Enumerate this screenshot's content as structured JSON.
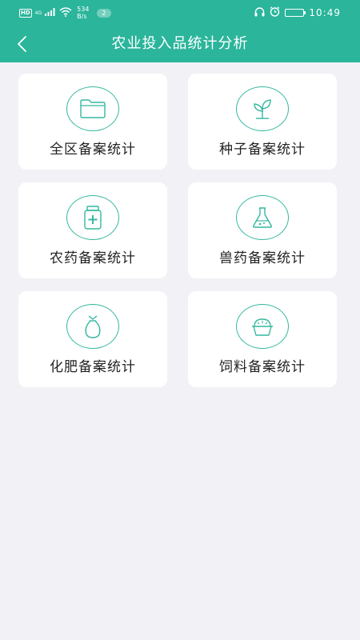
{
  "status_bar": {
    "hd": "HD",
    "network": "4G",
    "speed_value": "534",
    "speed_unit": "B/s",
    "notification_count": "2",
    "time": "10:49"
  },
  "header": {
    "title": "农业投入品统计分析",
    "back_icon": "chevron-left-icon"
  },
  "menu": [
    {
      "label": "全区备案统计",
      "icon": "folder-icon"
    },
    {
      "label": "种子备案统计",
      "icon": "sprout-icon"
    },
    {
      "label": "农药备案统计",
      "icon": "medicine-bottle-icon"
    },
    {
      "label": "兽药备案统计",
      "icon": "flask-icon"
    },
    {
      "label": "化肥备案统计",
      "icon": "fertilizer-bag-icon"
    },
    {
      "label": "饲料备案统计",
      "icon": "feed-bowl-icon"
    }
  ],
  "colors": {
    "primary": "#2bb59b",
    "icon_stroke": "#34b89f",
    "background": "#f2f2f6",
    "card": "#ffffff",
    "text": "#222222"
  }
}
